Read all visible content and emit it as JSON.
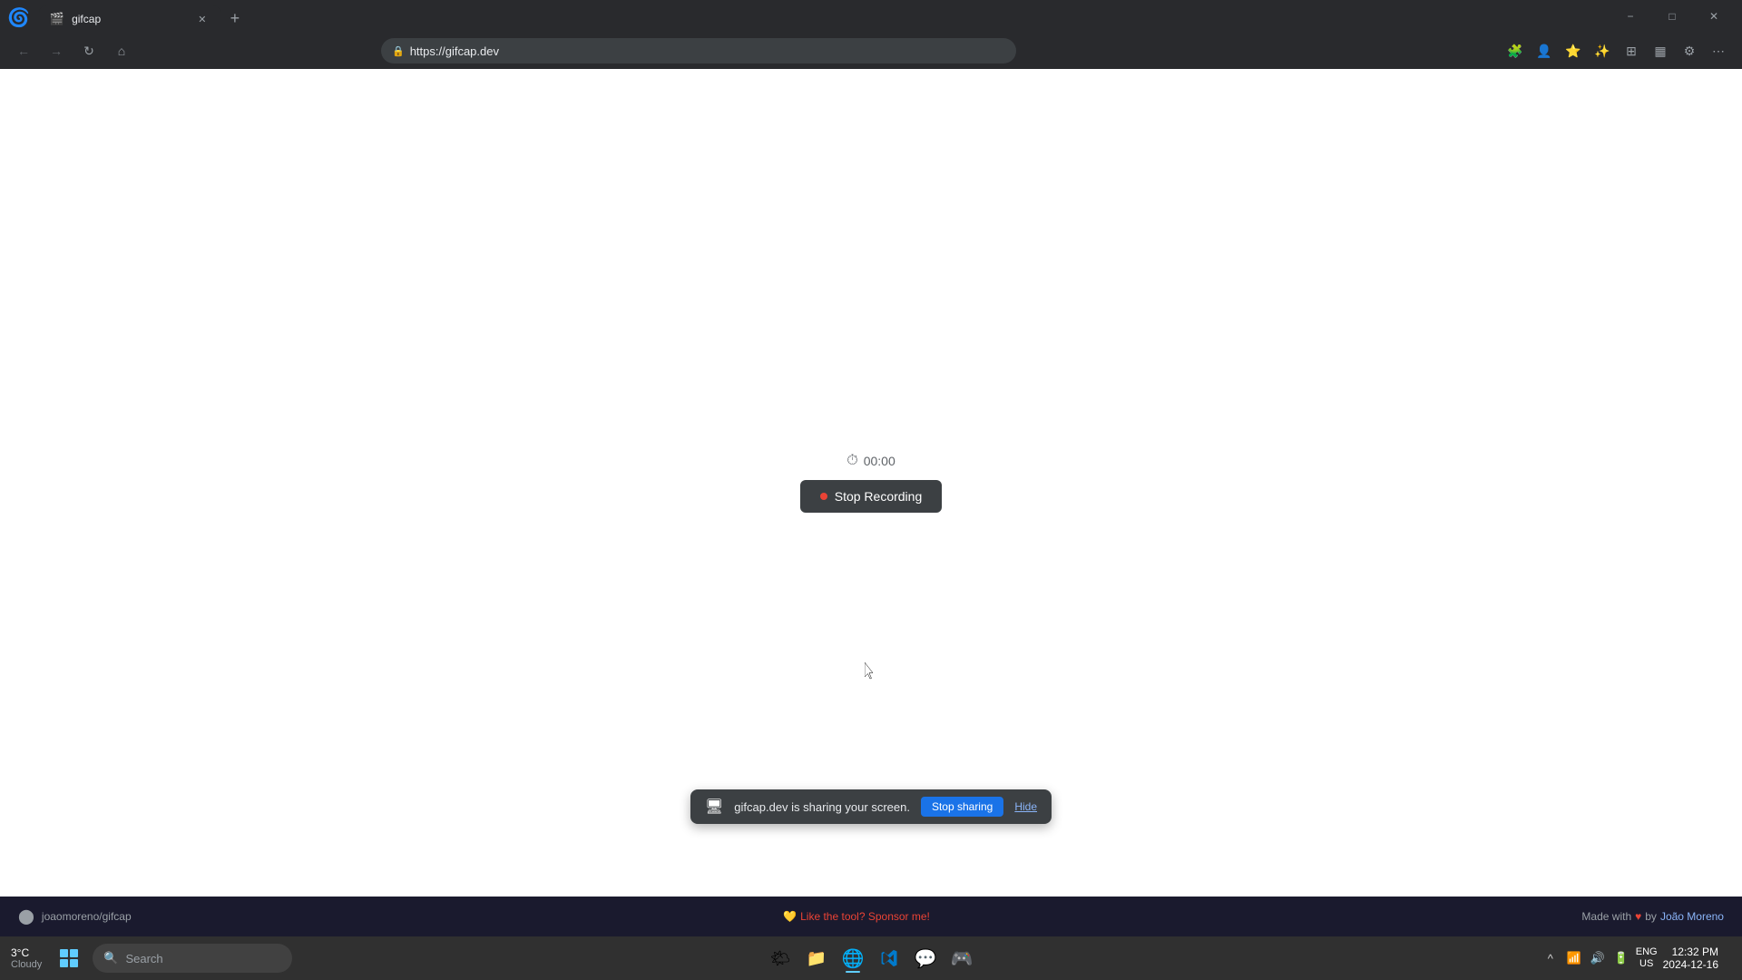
{
  "browser": {
    "tab": {
      "title": "gifcap",
      "favicon_char": "🎬",
      "active": true
    },
    "url": "https://gifcap.dev",
    "window_controls": {
      "minimize": "−",
      "maximize": "□",
      "close": "✕"
    }
  },
  "toolbar_buttons": {
    "back": "←",
    "forward": "→",
    "refresh": "↻",
    "home": "⌂"
  },
  "page": {
    "timer": "00:00",
    "stop_recording_label": "Stop Recording",
    "stop_recording_dot": "■"
  },
  "sharing_bar": {
    "icon": "🖥",
    "message": "gifcap.dev is sharing your screen.",
    "stop_label": "Stop sharing",
    "hide_label": "Hide"
  },
  "footer": {
    "github_user": "joaomoreno/gifcap",
    "sponsor_text": "Like the tool? Sponsor me!",
    "made_with": "Made with",
    "heart": "♥",
    "by": "by",
    "author": "João Moreno"
  },
  "taskbar": {
    "start_label": "Start",
    "search_placeholder": "Search",
    "apps": [
      {
        "id": "widgets",
        "icon": "🌤",
        "label": "Widgets"
      },
      {
        "id": "files",
        "icon": "📁",
        "label": "Files"
      },
      {
        "id": "edge",
        "icon": "🌐",
        "label": "Microsoft Edge"
      },
      {
        "id": "vscode",
        "icon": "💙",
        "label": "Visual Studio Code"
      },
      {
        "id": "discord",
        "icon": "💬",
        "label": "Discord"
      },
      {
        "id": "xbox",
        "icon": "🎮",
        "label": "Xbox"
      }
    ],
    "tray": {
      "chevron": "^",
      "network": "📶",
      "volume": "🔊",
      "battery": "🔋",
      "ime": "ENG\nUS"
    },
    "clock": {
      "time": "12:32 PM",
      "date": "2024-12-16"
    },
    "weather": {
      "temp": "3°C",
      "desc": "Cloudy"
    }
  }
}
